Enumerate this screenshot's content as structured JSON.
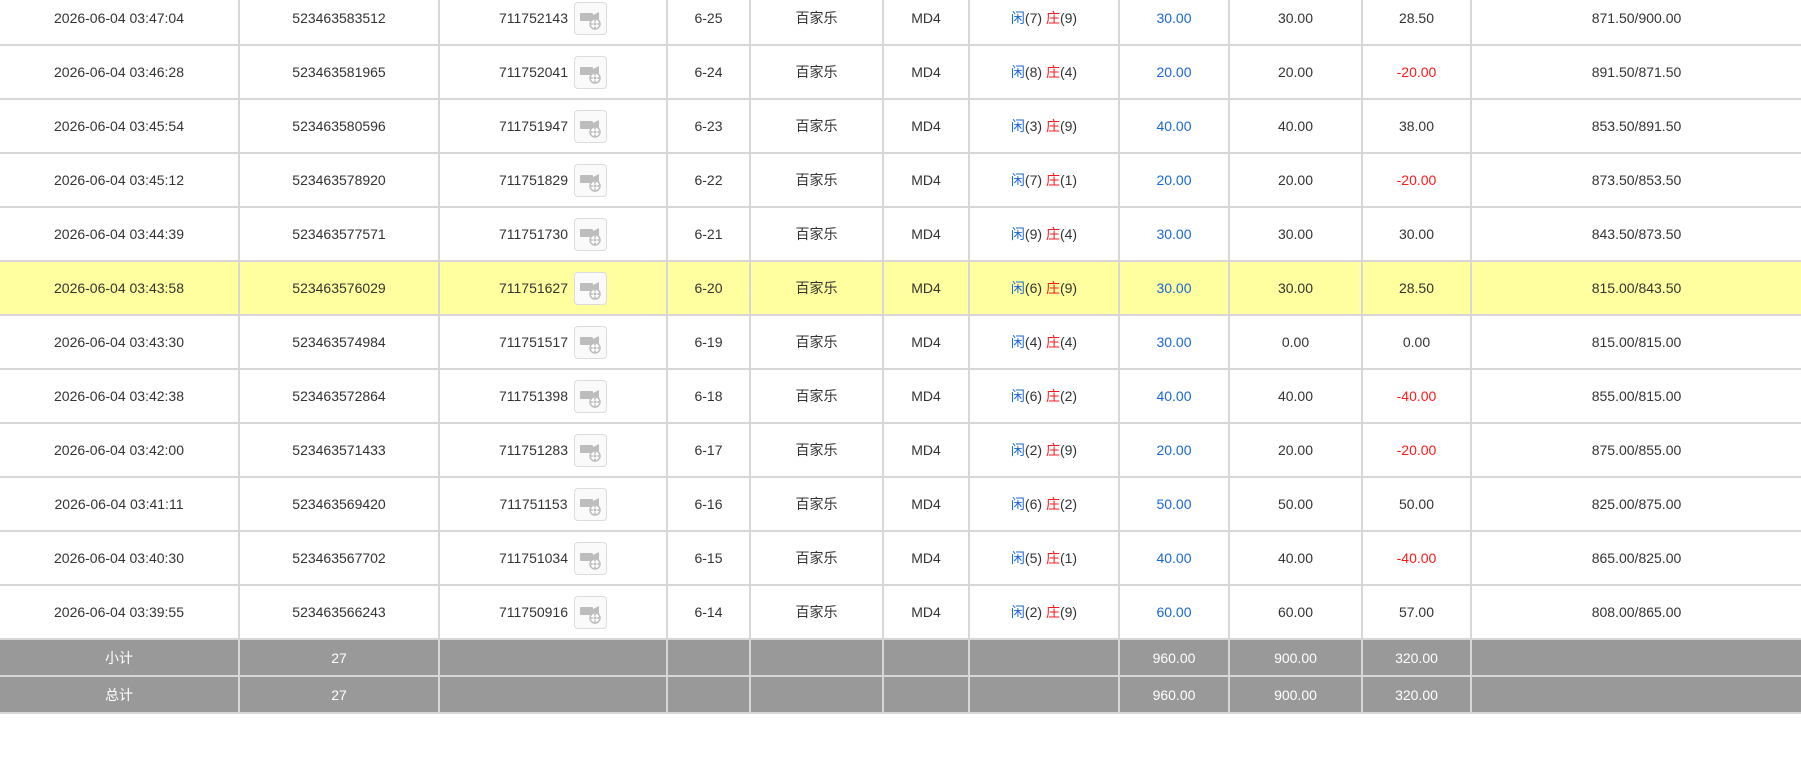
{
  "colors": {
    "blue": "#1a66d8",
    "red": "#ff1a1a",
    "highlight": "#ffff9f",
    "summary_bg": "#999999",
    "border": "#d7d7d7"
  },
  "rows": [
    {
      "time": "2026-06-04 03:47:04",
      "bet_id": "523463583512",
      "game_no": "711752143",
      "round": "6-25",
      "game": "百家乐",
      "table": "MD4",
      "player_label": "闲",
      "player_val": "(7)",
      "banker_label": "庄",
      "banker_val": "(9)",
      "bet": "30.00",
      "valid": "30.00",
      "win": "28.50",
      "win_negative": false,
      "balance": "871.50/900.00",
      "highlight": false
    },
    {
      "time": "2026-06-04 03:46:28",
      "bet_id": "523463581965",
      "game_no": "711752041",
      "round": "6-24",
      "game": "百家乐",
      "table": "MD4",
      "player_label": "闲",
      "player_val": "(8)",
      "banker_label": "庄",
      "banker_val": "(4)",
      "bet": "20.00",
      "valid": "20.00",
      "win": "-20.00",
      "win_negative": true,
      "balance": "891.50/871.50",
      "highlight": false
    },
    {
      "time": "2026-06-04 03:45:54",
      "bet_id": "523463580596",
      "game_no": "711751947",
      "round": "6-23",
      "game": "百家乐",
      "table": "MD4",
      "player_label": "闲",
      "player_val": "(3)",
      "banker_label": "庄",
      "banker_val": "(9)",
      "bet": "40.00",
      "valid": "40.00",
      "win": "38.00",
      "win_negative": false,
      "balance": "853.50/891.50",
      "highlight": false
    },
    {
      "time": "2026-06-04 03:45:12",
      "bet_id": "523463578920",
      "game_no": "711751829",
      "round": "6-22",
      "game": "百家乐",
      "table": "MD4",
      "player_label": "闲",
      "player_val": "(7)",
      "banker_label": "庄",
      "banker_val": "(1)",
      "bet": "20.00",
      "valid": "20.00",
      "win": "-20.00",
      "win_negative": true,
      "balance": "873.50/853.50",
      "highlight": false
    },
    {
      "time": "2026-06-04 03:44:39",
      "bet_id": "523463577571",
      "game_no": "711751730",
      "round": "6-21",
      "game": "百家乐",
      "table": "MD4",
      "player_label": "闲",
      "player_val": "(9)",
      "banker_label": "庄",
      "banker_val": "(4)",
      "bet": "30.00",
      "valid": "30.00",
      "win": "30.00",
      "win_negative": false,
      "balance": "843.50/873.50",
      "highlight": false
    },
    {
      "time": "2026-06-04 03:43:58",
      "bet_id": "523463576029",
      "game_no": "711751627",
      "round": "6-20",
      "game": "百家乐",
      "table": "MD4",
      "player_label": "闲",
      "player_val": "(6)",
      "banker_label": "庄",
      "banker_val": "(9)",
      "bet": "30.00",
      "valid": "30.00",
      "win": "28.50",
      "win_negative": false,
      "balance": "815.00/843.50",
      "highlight": true
    },
    {
      "time": "2026-06-04 03:43:30",
      "bet_id": "523463574984",
      "game_no": "711751517",
      "round": "6-19",
      "game": "百家乐",
      "table": "MD4",
      "player_label": "闲",
      "player_val": "(4)",
      "banker_label": "庄",
      "banker_val": "(4)",
      "bet": "30.00",
      "valid": "0.00",
      "win": "0.00",
      "win_negative": false,
      "balance": "815.00/815.00",
      "highlight": false
    },
    {
      "time": "2026-06-04 03:42:38",
      "bet_id": "523463572864",
      "game_no": "711751398",
      "round": "6-18",
      "game": "百家乐",
      "table": "MD4",
      "player_label": "闲",
      "player_val": "(6)",
      "banker_label": "庄",
      "banker_val": "(2)",
      "bet": "40.00",
      "valid": "40.00",
      "win": "-40.00",
      "win_negative": true,
      "balance": "855.00/815.00",
      "highlight": false
    },
    {
      "time": "2026-06-04 03:42:00",
      "bet_id": "523463571433",
      "game_no": "711751283",
      "round": "6-17",
      "game": "百家乐",
      "table": "MD4",
      "player_label": "闲",
      "player_val": "(2)",
      "banker_label": "庄",
      "banker_val": "(9)",
      "bet": "20.00",
      "valid": "20.00",
      "win": "-20.00",
      "win_negative": true,
      "balance": "875.00/855.00",
      "highlight": false
    },
    {
      "time": "2026-06-04 03:41:11",
      "bet_id": "523463569420",
      "game_no": "711751153",
      "round": "6-16",
      "game": "百家乐",
      "table": "MD4",
      "player_label": "闲",
      "player_val": "(6)",
      "banker_label": "庄",
      "banker_val": "(2)",
      "bet": "50.00",
      "valid": "50.00",
      "win": "50.00",
      "win_negative": false,
      "balance": "825.00/875.00",
      "highlight": false
    },
    {
      "time": "2026-06-04 03:40:30",
      "bet_id": "523463567702",
      "game_no": "711751034",
      "round": "6-15",
      "game": "百家乐",
      "table": "MD4",
      "player_label": "闲",
      "player_val": "(5)",
      "banker_label": "庄",
      "banker_val": "(1)",
      "bet": "40.00",
      "valid": "40.00",
      "win": "-40.00",
      "win_negative": true,
      "balance": "865.00/825.00",
      "highlight": false
    },
    {
      "time": "2026-06-04 03:39:55",
      "bet_id": "523463566243",
      "game_no": "711750916",
      "round": "6-14",
      "game": "百家乐",
      "table": "MD4",
      "player_label": "闲",
      "player_val": "(2)",
      "banker_label": "庄",
      "banker_val": "(9)",
      "bet": "60.00",
      "valid": "60.00",
      "win": "57.00",
      "win_negative": false,
      "balance": "808.00/865.00",
      "highlight": false
    }
  ],
  "summary": [
    {
      "label": "小计",
      "count": "27",
      "bet": "960.00",
      "valid": "900.00",
      "win": "320.00"
    },
    {
      "label": "总计",
      "count": "27",
      "bet": "960.00",
      "valid": "900.00",
      "win": "320.00"
    }
  ],
  "icons": {
    "record": "video-camera-icon"
  }
}
